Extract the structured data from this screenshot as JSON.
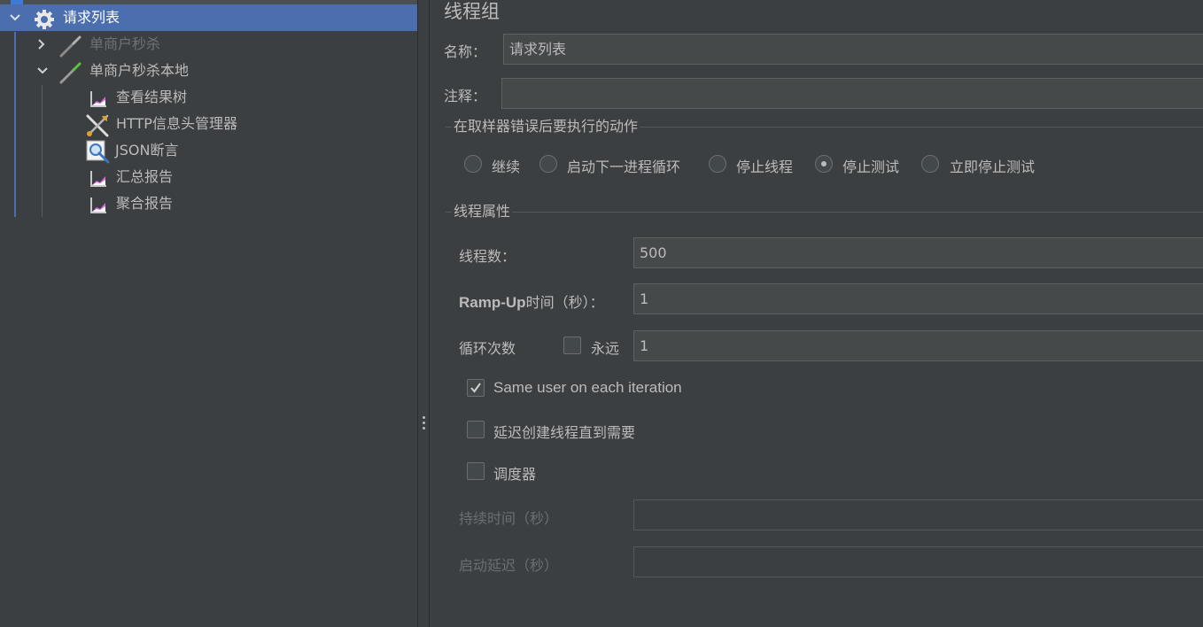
{
  "tree": {
    "root": {
      "label": "请求列表",
      "icon": "gear-icon"
    },
    "items": [
      {
        "label": "单商户秒杀",
        "icon": "pipette-icon",
        "disabled": true,
        "expanded": false
      },
      {
        "label": "单商户秒杀本地",
        "icon": "pipette-icon",
        "disabled": false,
        "expanded": true
      },
      {
        "label": "查看结果树",
        "icon": "graph-listener-icon"
      },
      {
        "label": "HTTP信息头管理器",
        "icon": "tools-icon"
      },
      {
        "label": "JSON断言",
        "icon": "magnifier-icon"
      },
      {
        "label": "汇总报告",
        "icon": "graph-listener-icon"
      },
      {
        "label": "聚合报告",
        "icon": "graph-listener-icon"
      }
    ]
  },
  "panel": {
    "title": "线程组",
    "name_label": "名称：",
    "name_value": "请求列表",
    "comment_label": "注释：",
    "comment_value": "",
    "error_action": {
      "title": "在取样器错误后要执行的动作",
      "options": [
        "继续",
        "启动下一进程循环",
        "停止线程",
        "停止测试",
        "立即停止测试"
      ],
      "selected_index": 3
    },
    "thread_props": {
      "title": "线程属性",
      "threads_label": "线程数：",
      "threads_value": "500",
      "rampup_label_bold": "Ramp-Up",
      "rampup_label_rest": "时间（秒）：",
      "rampup_value": "1",
      "loop_label": "循环次数",
      "forever_label": "永远",
      "forever_checked": false,
      "loop_value": "1",
      "same_user_label": "Same user on each iteration",
      "same_user_checked": true,
      "delay_create_label": "延迟创建线程直到需要",
      "delay_create_checked": false,
      "scheduler_label": "调度器",
      "scheduler_checked": false,
      "duration_label": "持续时间（秒）",
      "duration_value": "",
      "startup_delay_label": "启动延迟（秒）",
      "startup_delay_value": ""
    }
  },
  "colors": {
    "background": "#3c3f41",
    "selection": "#4b6eaf",
    "text": "#bbbbbb",
    "field_bg": "#45494a"
  }
}
